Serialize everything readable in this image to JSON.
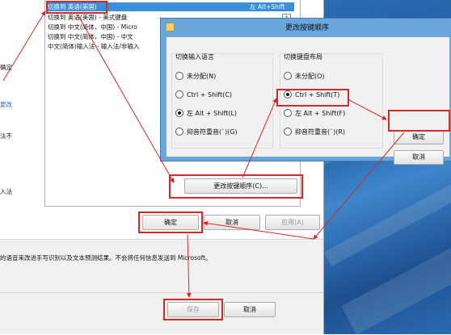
{
  "list": {
    "rows": [
      {
        "text": "切换到 英语(美国)",
        "hotkey": "左 Alt+Shift",
        "selected": true
      },
      {
        "text": "切换到 英语(美国) - 美式键盘",
        "selected": false
      },
      {
        "text": "切换到 中文(简体，中国) - Micro",
        "selected": false
      },
      {
        "text": "切换到 中文(简体，中国) - 中文",
        "selected": false
      },
      {
        "text": "中文(简体)输入法 - 输入法/非输入",
        "selected": false
      }
    ]
  },
  "left_fragments": [
    "确定",
    "更改",
    "法不",
    "入法"
  ],
  "back_dialog": {
    "change_sequence_button": "更改按键顺序(C)...",
    "ok": "确定",
    "cancel": "取消",
    "apply": "应用(A)",
    "description": "的语音来改进手写识别以及文本预测结果。不会将任何信息发送到 Microsoft。",
    "save": "保存",
    "cancel2": "取消"
  },
  "front_dialog": {
    "title": "更改按键顺序",
    "input_language_group": {
      "label": "切换输入语言",
      "options": [
        {
          "label": "未分配(N)",
          "checked": false
        },
        {
          "label": "Ctrl + Shift(C)",
          "checked": false
        },
        {
          "label": "左 Alt + Shift(L)",
          "checked": true
        },
        {
          "label": "抑音符重音(`)(G)",
          "checked": false
        }
      ]
    },
    "keyboard_layout_group": {
      "label": "切换键盘布局",
      "options": [
        {
          "label": "未分配(O)",
          "checked": false
        },
        {
          "label": "Ctrl + Shift(T)",
          "checked": true
        },
        {
          "label": "左 Alt + Shift(F)",
          "checked": false
        },
        {
          "label": "抑音符重音(`)(R)",
          "checked": false
        }
      ]
    },
    "ok": "确定",
    "cancel": "取消"
  },
  "colors": {
    "highlight": "#d22a2a",
    "selection": "#3b8ed8",
    "title_bar": "#6aa6dc"
  }
}
